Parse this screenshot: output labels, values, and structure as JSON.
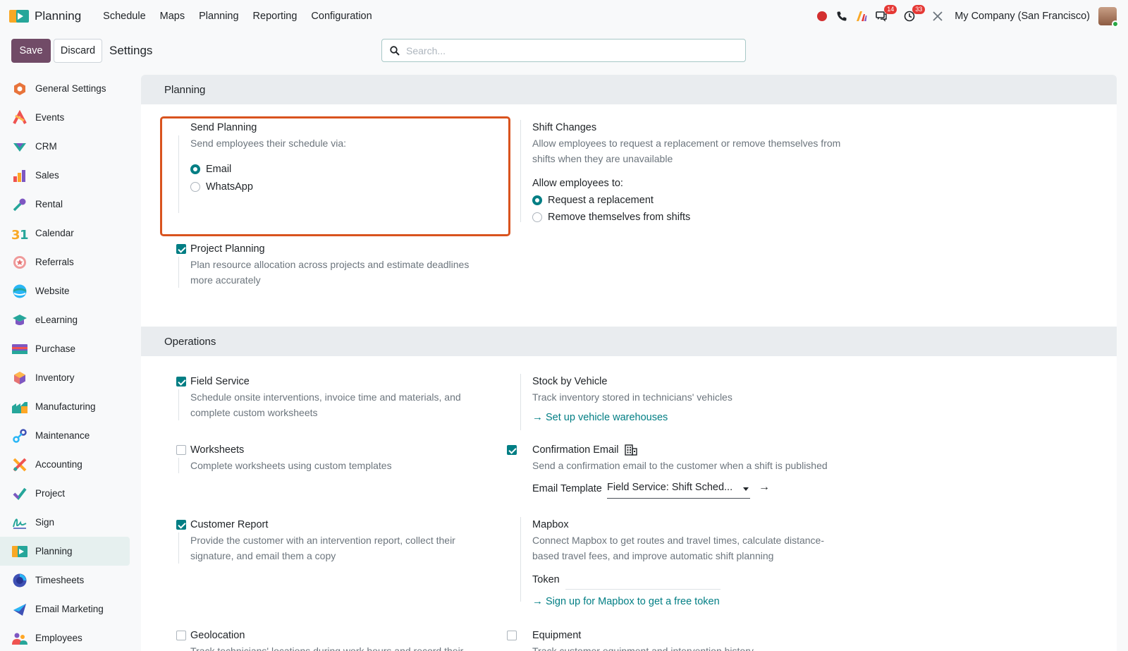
{
  "navbar": {
    "app_name": "Planning",
    "menu": [
      "Schedule",
      "Maps",
      "Planning",
      "Reporting",
      "Configuration"
    ],
    "messages_badge": "14",
    "activities_badge": "33",
    "company": "My Company (San Francisco)"
  },
  "control": {
    "save_label": "Save",
    "discard_label": "Discard",
    "title": "Settings",
    "search_placeholder": "Search..."
  },
  "sidebar": {
    "items": [
      {
        "label": "General Settings",
        "icon": "general-settings-icon"
      },
      {
        "label": "Events",
        "icon": "events-icon"
      },
      {
        "label": "CRM",
        "icon": "crm-icon"
      },
      {
        "label": "Sales",
        "icon": "sales-icon"
      },
      {
        "label": "Rental",
        "icon": "rental-icon"
      },
      {
        "label": "Calendar",
        "icon": "calendar-icon"
      },
      {
        "label": "Referrals",
        "icon": "referrals-icon"
      },
      {
        "label": "Website",
        "icon": "website-icon"
      },
      {
        "label": "eLearning",
        "icon": "elearning-icon"
      },
      {
        "label": "Purchase",
        "icon": "purchase-icon"
      },
      {
        "label": "Inventory",
        "icon": "inventory-icon"
      },
      {
        "label": "Manufacturing",
        "icon": "manufacturing-icon"
      },
      {
        "label": "Maintenance",
        "icon": "maintenance-icon"
      },
      {
        "label": "Accounting",
        "icon": "accounting-icon"
      },
      {
        "label": "Project",
        "icon": "project-icon"
      },
      {
        "label": "Sign",
        "icon": "sign-icon"
      },
      {
        "label": "Planning",
        "icon": "planning-icon",
        "active": true
      },
      {
        "label": "Timesheets",
        "icon": "timesheets-icon"
      },
      {
        "label": "Email Marketing",
        "icon": "email-marketing-icon"
      },
      {
        "label": "Employees",
        "icon": "employees-icon"
      }
    ]
  },
  "planning_section": {
    "header": "Planning",
    "send_planning": {
      "title": "Send Planning",
      "desc": "Send employees their schedule via:",
      "options": [
        "Email",
        "WhatsApp"
      ],
      "selected": "Email"
    },
    "shift_changes": {
      "title": "Shift Changes",
      "desc": "Allow employees to request a replacement or remove themselves from shifts when they are unavailable",
      "allow_label": "Allow employees to:",
      "options": [
        "Request a replacement",
        "Remove themselves from shifts"
      ],
      "selected": "Request a replacement"
    },
    "project_planning": {
      "title": "Project Planning",
      "desc": "Plan resource allocation across projects and estimate deadlines more accurately",
      "checked": true
    }
  },
  "operations_section": {
    "header": "Operations",
    "field_service": {
      "title": "Field Service",
      "desc": "Schedule onsite interventions, invoice time and materials, and complete custom worksheets",
      "checked": true
    },
    "stock_by_vehicle": {
      "title": "Stock by Vehicle",
      "desc": "Track inventory stored in technicians' vehicles",
      "link": "Set up vehicle warehouses"
    },
    "worksheets": {
      "title": "Worksheets",
      "desc": "Complete worksheets using custom templates",
      "checked": false
    },
    "confirmation_email": {
      "title": "Confirmation Email",
      "desc": "Send a confirmation email to the customer when a shift is published",
      "checked": true,
      "template_label": "Email Template",
      "template_value": "Field Service: Shift Sched..."
    },
    "customer_report": {
      "title": "Customer Report",
      "desc": "Provide the customer with an intervention report, collect their signature, and email them a copy",
      "checked": true
    },
    "mapbox": {
      "title": "Mapbox",
      "desc": "Connect Mapbox to get routes and travel times, calculate distance-based travel fees, and improve automatic shift planning",
      "token_label": "Token",
      "link": "Sign up for Mapbox to get a free token"
    },
    "geolocation": {
      "title": "Geolocation",
      "desc": "Track technicians' locations during work hours and record their",
      "checked": false
    },
    "equipment": {
      "title": "Equipment",
      "desc": "Track customer equipment and intervention history",
      "checked": false
    }
  },
  "colors": {
    "primary": "#714b67",
    "accent": "#017e84",
    "highlight": "#d9531e"
  }
}
